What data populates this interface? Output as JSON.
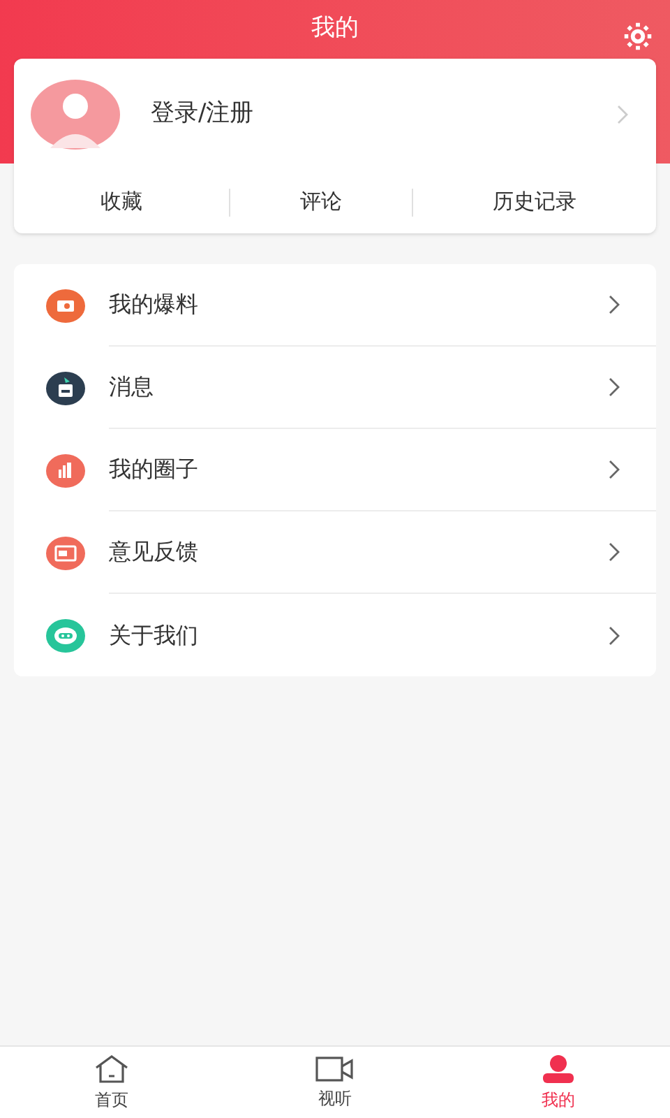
{
  "header": {
    "title": "我的"
  },
  "profile": {
    "login_label": "登录/注册"
  },
  "shortcuts": [
    "收藏",
    "评论",
    "历史记录"
  ],
  "menu": [
    {
      "label": "我的爆料",
      "kind": "camera",
      "color": "#ee6a3c"
    },
    {
      "label": "消息",
      "kind": "inbox",
      "color": "#2c3e50"
    },
    {
      "label": "我的圈子",
      "kind": "chart",
      "color": "#f06b5b"
    },
    {
      "label": "意见反馈",
      "kind": "card",
      "color": "#f06b5b"
    },
    {
      "label": "关于我们",
      "kind": "robot",
      "color": "#27c59a"
    }
  ],
  "tab_bar": [
    {
      "label": "首页",
      "kind": "home",
      "selected": false
    },
    {
      "label": "视听",
      "kind": "video",
      "selected": false
    },
    {
      "label": "我的",
      "kind": "user",
      "selected": true
    }
  ]
}
